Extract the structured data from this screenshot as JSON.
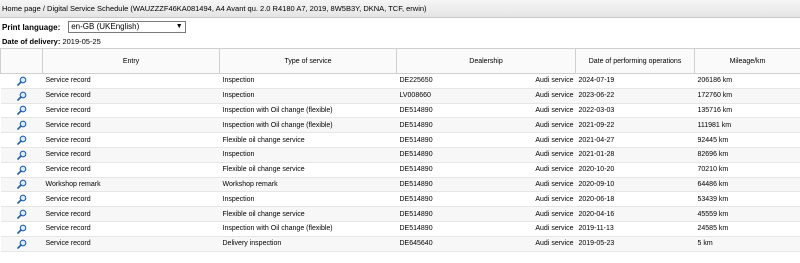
{
  "breadcrumb": "Home page / Digital Service Schedule (WAUZZZF46KA081494, A4 Avant qu. 2.0 R4180 A7, 2019, 8W5B3Y, DKNA, TCF, erwin)",
  "print_language": {
    "label": "Print language:",
    "selected": "en-GB (UKEnglish)"
  },
  "delivery": {
    "label": "Date of delivery:",
    "value": "2019-05-25"
  },
  "table": {
    "headers": {
      "entry": "Entry",
      "type": "Type of service",
      "dealership": "Dealership",
      "date": "Date of performing operations",
      "mileage": "Mileage/km"
    },
    "rows": [
      {
        "entry": "Service record",
        "type": "Inspection",
        "dealer_code": "DE225650",
        "dealer_name": "Audi service",
        "date": "2024-07-19",
        "mileage": "206186 km"
      },
      {
        "entry": "Service record",
        "type": "Inspection",
        "dealer_code": "LV008660",
        "dealer_name": "Audi service",
        "date": "2023-06-22",
        "mileage": "172760 km"
      },
      {
        "entry": "Service record",
        "type": "Inspection with Oil change (flexible)",
        "dealer_code": "DE514890",
        "dealer_name": "Audi service",
        "date": "2022-03-03",
        "mileage": "135716 km"
      },
      {
        "entry": "Service record",
        "type": "Inspection with Oil change (flexible)",
        "dealer_code": "DE514890",
        "dealer_name": "Audi service",
        "date": "2021-09-22",
        "mileage": "111981 km"
      },
      {
        "entry": "Service record",
        "type": "Flexible oil change service",
        "dealer_code": "DE514890",
        "dealer_name": "Audi service",
        "date": "2021-04-27",
        "mileage": "92445 km"
      },
      {
        "entry": "Service record",
        "type": "Inspection",
        "dealer_code": "DE514890",
        "dealer_name": "Audi service",
        "date": "2021-01-28",
        "mileage": "82696 km"
      },
      {
        "entry": "Service record",
        "type": "Flexible oil change service",
        "dealer_code": "DE514890",
        "dealer_name": "Audi service",
        "date": "2020-10-20",
        "mileage": "70210 km"
      },
      {
        "entry": "Workshop remark",
        "type": "Workshop remark",
        "dealer_code": "DE514890",
        "dealer_name": "Audi service",
        "date": "2020-09-10",
        "mileage": "64486 km"
      },
      {
        "entry": "Service record",
        "type": "Inspection",
        "dealer_code": "DE514890",
        "dealer_name": "Audi service",
        "date": "2020-06-18",
        "mileage": "53439 km"
      },
      {
        "entry": "Service record",
        "type": "Flexible oil change service",
        "dealer_code": "DE514890",
        "dealer_name": "Audi service",
        "date": "2020-04-16",
        "mileage": "45559 km"
      },
      {
        "entry": "Service record",
        "type": "Inspection with Oil change (flexible)",
        "dealer_code": "DE514890",
        "dealer_name": "Audi service",
        "date": "2019-11-13",
        "mileage": "24585 km"
      },
      {
        "entry": "Service record",
        "type": "Delivery inspection",
        "dealer_code": "DE645640",
        "dealer_name": "Audi service",
        "date": "2019-05-23",
        "mileage": "5 km"
      }
    ],
    "row_icon": "magnifier-icon"
  }
}
